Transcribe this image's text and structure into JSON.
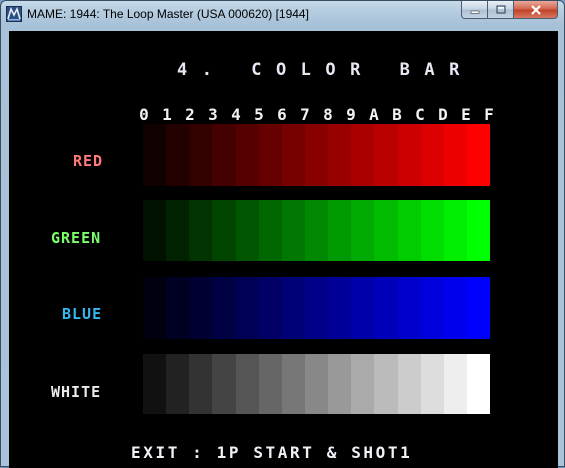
{
  "window": {
    "title": "MAME: 1944: The Loop Master (USA 000620) [1944]"
  },
  "screen": {
    "heading": "4. COLOR BAR",
    "hex_labels": [
      "0",
      "1",
      "2",
      "3",
      "4",
      "5",
      "6",
      "7",
      "8",
      "9",
      "A",
      "B",
      "C",
      "D",
      "E",
      "F"
    ],
    "bars": [
      {
        "label": "RED",
        "color": "#ff0000",
        "swatches": 15
      },
      {
        "label": "GREEN",
        "color": "#00ff00",
        "swatches": 15
      },
      {
        "label": "BLUE",
        "color": "#0000ff",
        "swatches": 15
      },
      {
        "label": "WHITE",
        "color": "#ffffff",
        "swatches": 15
      }
    ],
    "footer": "EXIT : 1P START & SHOT1"
  },
  "icons": {
    "app": "mame-icon",
    "minimize": "minimize-icon",
    "maximize": "maximize-icon",
    "close": "close-icon"
  }
}
